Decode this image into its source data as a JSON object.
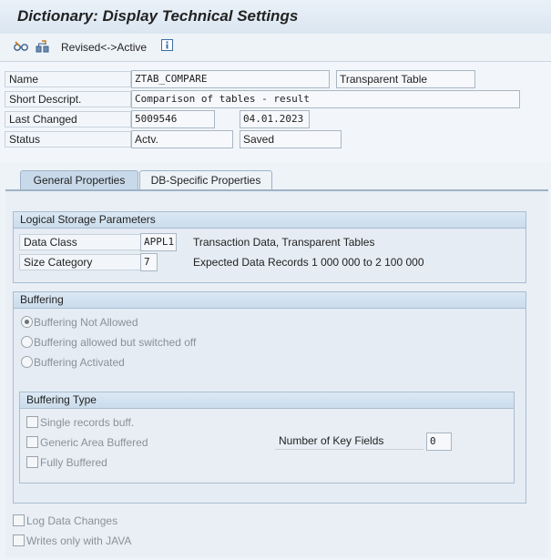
{
  "window": {
    "title": "Dictionary: Display Technical Settings"
  },
  "toolbar": {
    "icons": [
      "glasses-icon",
      "tree-icon",
      "info-icon"
    ],
    "revised_active_label": "Revised<->Active"
  },
  "header": {
    "name": {
      "label": "Name",
      "value": "ZTAB_COMPARE",
      "type": "Transparent Table"
    },
    "short_description": {
      "label": "Short Descript.",
      "value": "Comparison of tables - result"
    },
    "last_changed": {
      "label": "Last Changed",
      "user": "5009546",
      "date": "04.01.2023"
    },
    "status": {
      "label": "Status",
      "state": "Actv.",
      "save_state": "Saved"
    }
  },
  "tabs": [
    {
      "label": "General Properties",
      "active": true
    },
    {
      "label": "DB-Specific Properties",
      "active": false
    }
  ],
  "logical_storage": {
    "title": "Logical Storage Parameters",
    "data_class": {
      "label": "Data Class",
      "value": "APPL1",
      "description": "Transaction Data, Transparent Tables"
    },
    "size_category": {
      "label": "Size Category",
      "value": "7",
      "description": "Expected Data Records 1 000 000 to 2 100 000"
    }
  },
  "buffering": {
    "title": "Buffering",
    "options": [
      {
        "label": "Buffering Not Allowed",
        "selected": true
      },
      {
        "label": "Buffering allowed but switched off",
        "selected": false
      },
      {
        "label": "Buffering Activated",
        "selected": false
      }
    ]
  },
  "buffering_type": {
    "title": "Buffering Type",
    "options": [
      {
        "label": "Single records buff.",
        "checked": false
      },
      {
        "label": "Generic Area Buffered",
        "checked": false
      },
      {
        "label": "Fully Buffered",
        "checked": false
      }
    ],
    "key_fields": {
      "label": "Number of Key Fields",
      "value": "0"
    }
  },
  "footer_options": [
    {
      "label": "Log Data Changes",
      "checked": false
    },
    {
      "label": "Writes only with JAVA",
      "checked": false
    }
  ],
  "colors": {
    "tab_active": "#c8d9ea",
    "group_header": "#cbdcec",
    "disabled_text": "#8a9199"
  }
}
